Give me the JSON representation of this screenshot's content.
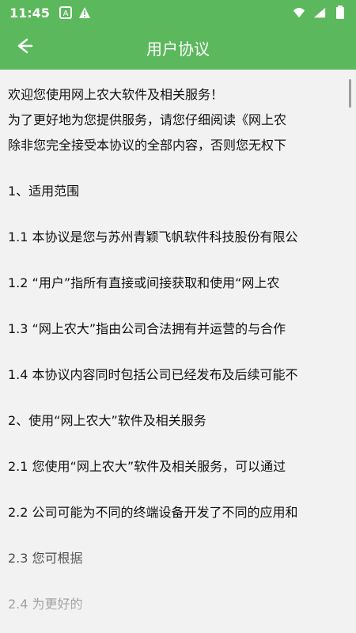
{
  "status": {
    "time": "11:45",
    "icons": [
      "a-box-icon",
      "warning-icon",
      "wifi-icon",
      "signal-icon",
      "battery-icon"
    ]
  },
  "app_bar": {
    "title": "用户协议",
    "back_icon": "arrow-left-icon"
  },
  "content": {
    "lines": [
      "欢迎您使用网上农大软件及相关服务！",
      "为了更好地为您提供服务，请您仔细阅读《网上农",
      "除非您完全接受本协议的全部内容，否则您无权下",
      "1、适用范围",
      "1.1 本协议是您与苏州青颖飞帆软件科技股份有限公",
      "1.2 “用户”指所有直接或间接获取和使用“网上农",
      "1.3 “网上农大”指由公司合法拥有并运营的与合作",
      "1.4 本协议内容同时包括公司已经发布及后续可能不",
      "2、使用“网上农大”软件及相关服务",
      "2.1 您使用“网上农大”软件及相关服务，可以通过",
      "2.2 公司可能为不同的终端设备开发了不同的应用和",
      "2.3 您可根据",
      "2.4 为更好的"
    ]
  }
}
